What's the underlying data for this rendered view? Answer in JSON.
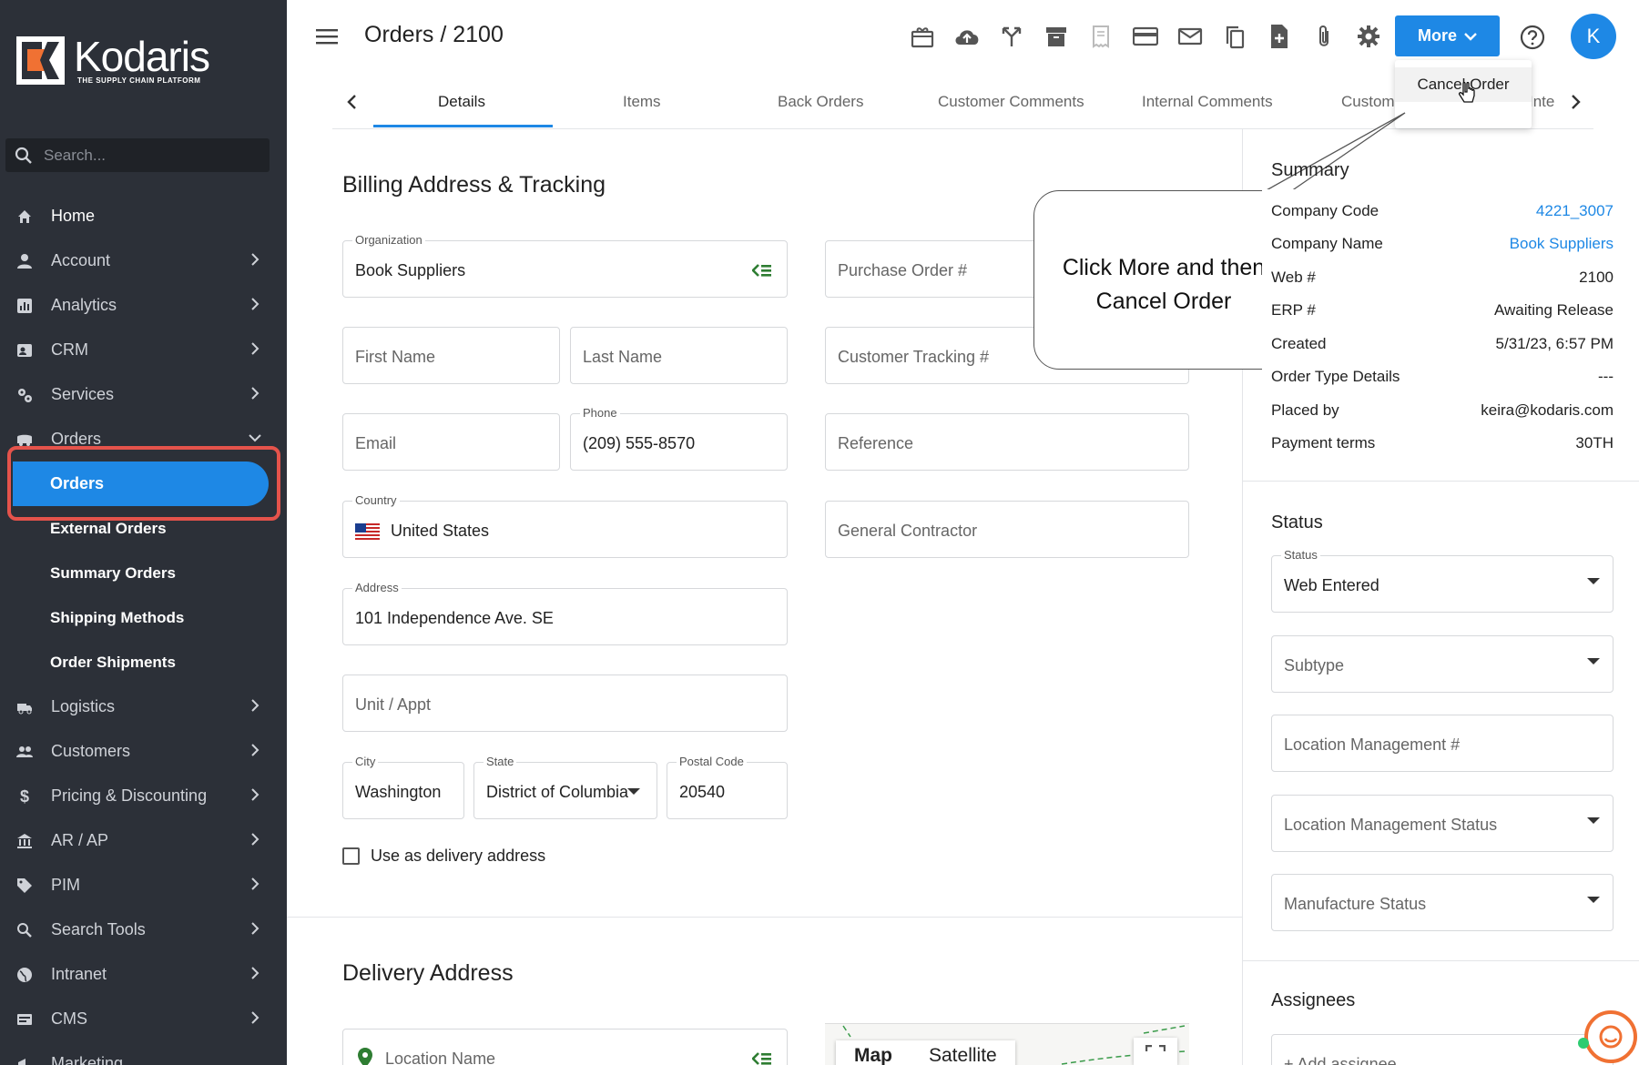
{
  "app": {
    "logo_name": "Kodaris",
    "logo_tagline": "THE SUPPLY CHAIN PLATFORM",
    "brand_color": "#1e88e5",
    "sidebar_bg": "#2c3038",
    "highlight_color": "#e5534b"
  },
  "sidebar": {
    "search_placeholder": "Search...",
    "items": [
      {
        "label": "Home",
        "icon": "home-icon"
      },
      {
        "label": "Account",
        "icon": "person-icon"
      },
      {
        "label": "Analytics",
        "icon": "analytics-icon"
      },
      {
        "label": "CRM",
        "icon": "contact-card-icon"
      },
      {
        "label": "Services",
        "icon": "gears-icon"
      },
      {
        "label": "Orders",
        "icon": "truck-icon",
        "expanded": true
      },
      {
        "label": "Logistics",
        "icon": "delivery-truck-icon"
      },
      {
        "label": "Customers",
        "icon": "people-icon"
      },
      {
        "label": "Pricing & Discounting",
        "icon": "dollar-icon"
      },
      {
        "label": "AR / AP",
        "icon": "bank-icon"
      },
      {
        "label": "PIM",
        "icon": "tag-icon"
      },
      {
        "label": "Search Tools",
        "icon": "search-icon"
      },
      {
        "label": "Intranet",
        "icon": "globe-icon"
      },
      {
        "label": "CMS",
        "icon": "cms-icon"
      },
      {
        "label": "Marketing",
        "icon": "megaphone-icon"
      }
    ],
    "order_subitems": [
      {
        "label": "Orders",
        "active": true
      },
      {
        "label": "External Orders"
      },
      {
        "label": "Summary Orders"
      },
      {
        "label": "Shipping Methods"
      },
      {
        "label": "Order Shipments"
      }
    ]
  },
  "header": {
    "title": "Orders / 2100",
    "toolbar_icons": [
      "gift-icon",
      "cloud-upload-icon",
      "merge-icon",
      "archive-icon",
      "receipt-icon",
      "credit-card-icon",
      "mail-icon",
      "copy-icon",
      "add-document-icon",
      "attachment-icon",
      "gear-icon"
    ],
    "more_label": "More",
    "avatar_initial": "K"
  },
  "tabs": {
    "items": [
      "Details",
      "Items",
      "Back Orders",
      "Customer Comments",
      "Internal Comments",
      "Custom",
      "Inte"
    ],
    "active": "Details"
  },
  "more_menu": {
    "items": [
      "Cancel Order"
    ]
  },
  "callout": {
    "text_line1": "Click More and then",
    "text_line2": "Cancel Order"
  },
  "billing": {
    "title": "Billing Address & Tracking",
    "organization_label": "Organization",
    "organization_value": "Book Suppliers",
    "first_name_placeholder": "First Name",
    "last_name_placeholder": "Last Name",
    "email_placeholder": "Email",
    "phone_label": "Phone",
    "phone_value": "(209) 555-8570",
    "country_label": "Country",
    "country_value": "United States",
    "address_label": "Address",
    "address_value": "101 Independence Ave. SE",
    "unit_placeholder": "Unit / Appt",
    "city_label": "City",
    "city_value": "Washington",
    "state_label": "State",
    "state_value": "District of Columbia",
    "postal_label": "Postal Code",
    "postal_value": "20540",
    "purchase_order_placeholder": "Purchase Order #",
    "customer_tracking_placeholder": "Customer Tracking #",
    "reference_placeholder": "Reference",
    "general_contractor_placeholder": "General Contractor",
    "use_delivery_label": "Use as delivery address"
  },
  "delivery": {
    "title": "Delivery Address",
    "location_placeholder": "Location Name",
    "map_tab": "Map",
    "satellite_tab": "Satellite"
  },
  "summary": {
    "title": "Summary",
    "rows": [
      {
        "key": "Company Code",
        "value": "4221_3007",
        "link": true
      },
      {
        "key": "Company Name",
        "value": "Book Suppliers",
        "link": true
      },
      {
        "key": "Web #",
        "value": "2100"
      },
      {
        "key": "ERP #",
        "value": "Awaiting Release"
      },
      {
        "key": "Created",
        "value": "5/31/23, 6:57 PM"
      },
      {
        "key": "Order Type Details",
        "value": "---"
      },
      {
        "key": "Placed by",
        "value": "keira@kodaris.com"
      },
      {
        "key": "Payment terms",
        "value": "30TH"
      }
    ]
  },
  "status": {
    "title": "Status",
    "status_label": "Status",
    "status_value": "Web Entered",
    "subtype_placeholder": "Subtype",
    "location_mgmt_placeholder": "Location Management #",
    "location_mgmt_status_placeholder": "Location Management Status",
    "manufacture_status_placeholder": "Manufacture Status"
  },
  "assignees": {
    "title": "Assignees",
    "add_placeholder": "+ Add assignee"
  }
}
